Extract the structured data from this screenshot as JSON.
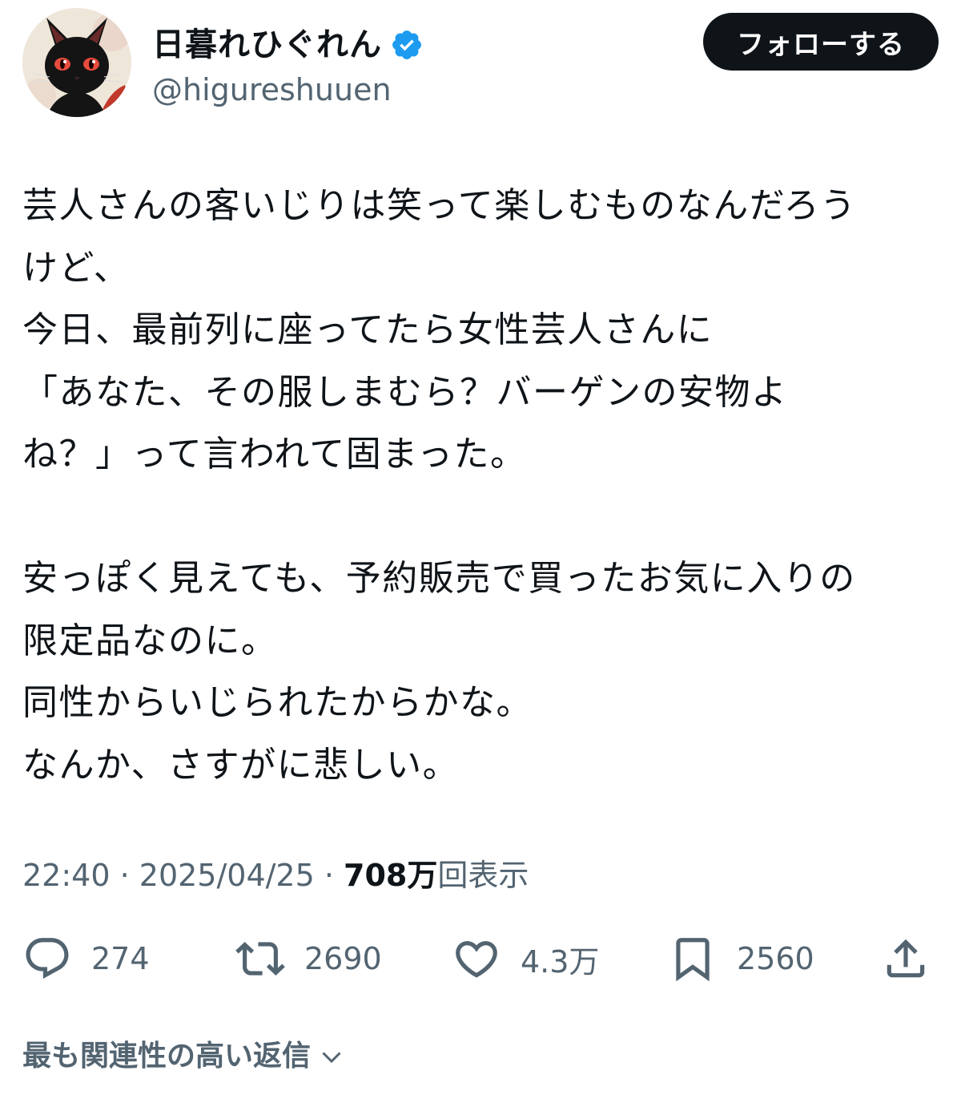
{
  "author": {
    "display_name": "日暮れひぐれん",
    "handle": "@higureshuuen",
    "verified": true,
    "avatar_icon": "black-cat-avatar-icon"
  },
  "follow_button": {
    "label": "フォローする"
  },
  "tweet": {
    "lines": [
      "芸人さんの客いじりは笑って楽しむものなんだろう",
      "けど、",
      "今日、最前列に座ってたら女性芸人さんに",
      "「あなた、その服しまむら？バーゲンの安物よ",
      "ね？」って言われて固まった。",
      "",
      "安っぽく見えても、予約販売で買ったお気に入りの",
      "限定品なのに。",
      "同性からいじられたからかな。",
      "なんか、さすがに悲しい。"
    ]
  },
  "meta": {
    "time": "22:40",
    "date": "2025/04/25",
    "separator": " · ",
    "views_count": "708万",
    "views_label": "回表示"
  },
  "actions": {
    "reply_count": "274",
    "retweet_count": "2690",
    "like_count": "4.3万",
    "bookmark_count": "2560"
  },
  "replies_sort": {
    "label": "最も関連性の高い返信"
  },
  "colors": {
    "text": "#0f1419",
    "secondary_text": "#536471",
    "verified_badge": "#1d9bf0",
    "follow_button_bg": "#0f1419",
    "follow_button_text": "#ffffff"
  }
}
